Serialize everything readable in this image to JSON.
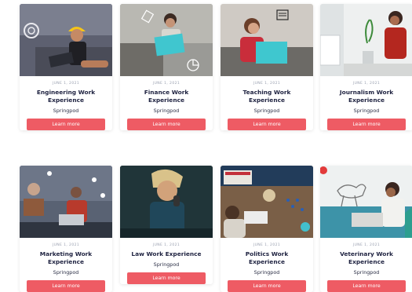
{
  "cards": [
    {
      "date": "JUNE 1, 2021",
      "title": "Engineering Work Experience",
      "org": "Springpod",
      "cta": "Learn more"
    },
    {
      "date": "JUNE 1, 2021",
      "title": "Finance Work Experience",
      "org": "Springpod",
      "cta": "Learn more"
    },
    {
      "date": "JUNE 1, 2021",
      "title": "Teaching Work Experience",
      "org": "Springpod",
      "cta": "Learn more"
    },
    {
      "date": "JUNE 1, 2021",
      "title": "Journalism Work Experience",
      "org": "Springpod",
      "cta": "Learn more"
    },
    {
      "date": "JUNE 1, 2021",
      "title": "Marketing Work Experience",
      "org": "Springpod",
      "cta": "Learn more"
    },
    {
      "date": "JUNE 1, 2021",
      "title": "Law Work Experience",
      "org": "Springpod",
      "cta": "Learn more"
    },
    {
      "date": "JUNE 1, 2021",
      "title": "Politics Work Experience",
      "org": "Springpod",
      "cta": "Learn more"
    },
    {
      "date": "JUNE 1, 2021",
      "title": "Veterinary Work Experience",
      "org": "Springpod",
      "cta": "Learn more"
    }
  ],
  "colors": {
    "accent": "#ee5b64",
    "title": "#1e2240",
    "date": "#9aa0b0"
  }
}
